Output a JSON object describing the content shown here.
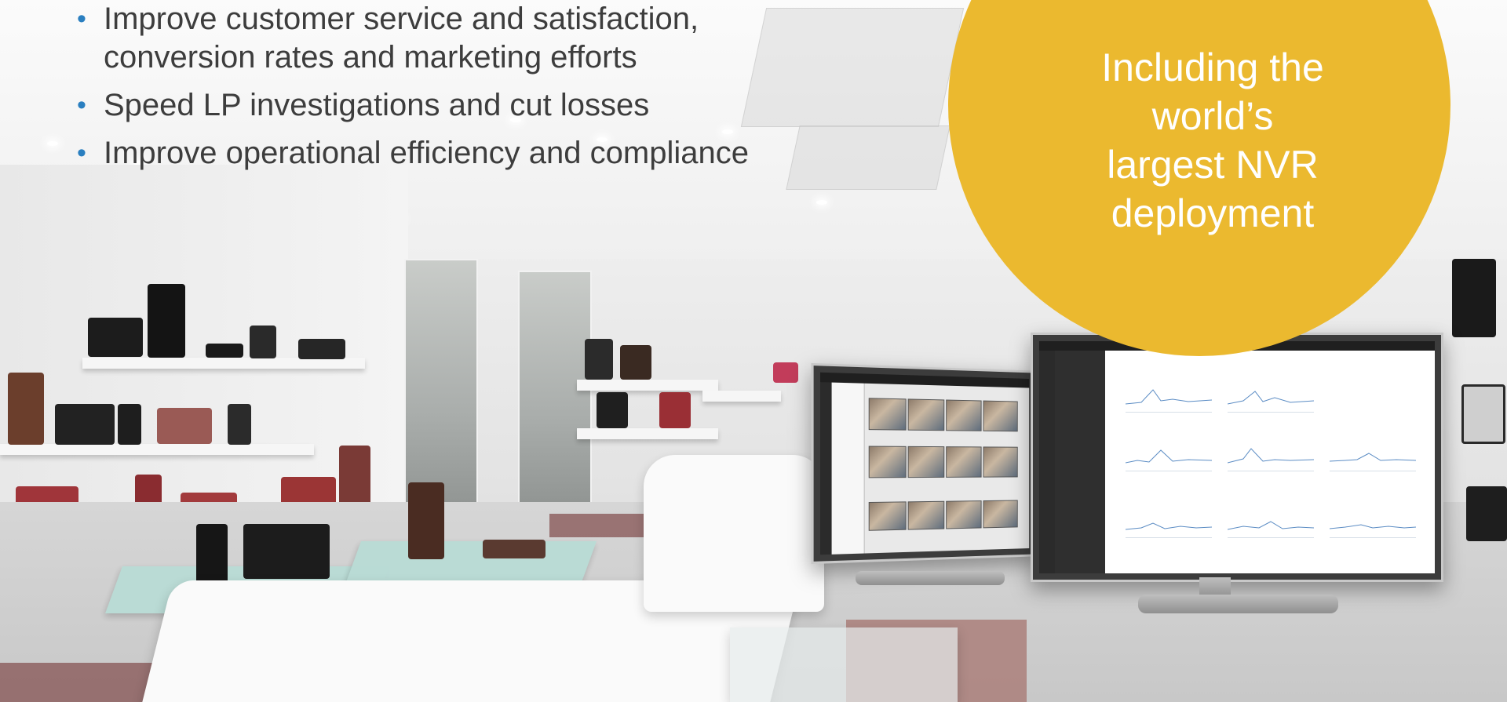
{
  "bullets": [
    "Improve customer service and satisfaction, conversion rates and marketing efforts",
    "Speed LP investigations and cut losses",
    "Improve operational efficiency and compliance"
  ],
  "callout": {
    "lines": [
      "Including the",
      "world’s",
      "largest NVR",
      "deployment"
    ]
  },
  "colors": {
    "callout": "#ebb92f",
    "bullet_dot": "#2a7fc0",
    "text": "#3d3d3d"
  }
}
